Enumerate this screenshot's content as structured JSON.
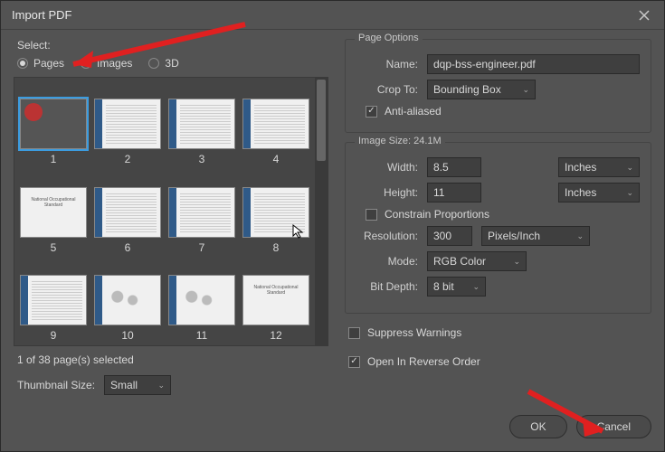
{
  "title": "Import PDF",
  "select_label": "Select:",
  "radios": {
    "pages": "Pages",
    "images": "Images",
    "threeD": "3D"
  },
  "thumbs": [
    "1",
    "2",
    "3",
    "4",
    "5",
    "6",
    "7",
    "8",
    "9",
    "10",
    "11",
    "12"
  ],
  "status": "1 of 38 page(s) selected",
  "thumb_size": {
    "label": "Thumbnail Size:",
    "value": "Small"
  },
  "page_options": {
    "legend": "Page Options",
    "name_label": "Name:",
    "name_value": "dqp-bss-engineer.pdf",
    "crop_label": "Crop To:",
    "crop_value": "Bounding Box",
    "anti_aliased": "Anti-aliased"
  },
  "image_size": {
    "legend": "Image Size: 24.1M",
    "width_label": "Width:",
    "width_value": "8.5",
    "width_unit": "Inches",
    "height_label": "Height:",
    "height_value": "11",
    "height_unit": "Inches",
    "constrain": "Constrain Proportions",
    "resolution_label": "Resolution:",
    "resolution_value": "300",
    "resolution_unit": "Pixels/Inch",
    "mode_label": "Mode:",
    "mode_value": "RGB Color",
    "bitdepth_label": "Bit Depth:",
    "bitdepth_value": "8 bit"
  },
  "suppress_warnings": "Suppress Warnings",
  "reverse_order": "Open In Reverse Order",
  "buttons": {
    "ok": "OK",
    "cancel": "Cancel"
  }
}
